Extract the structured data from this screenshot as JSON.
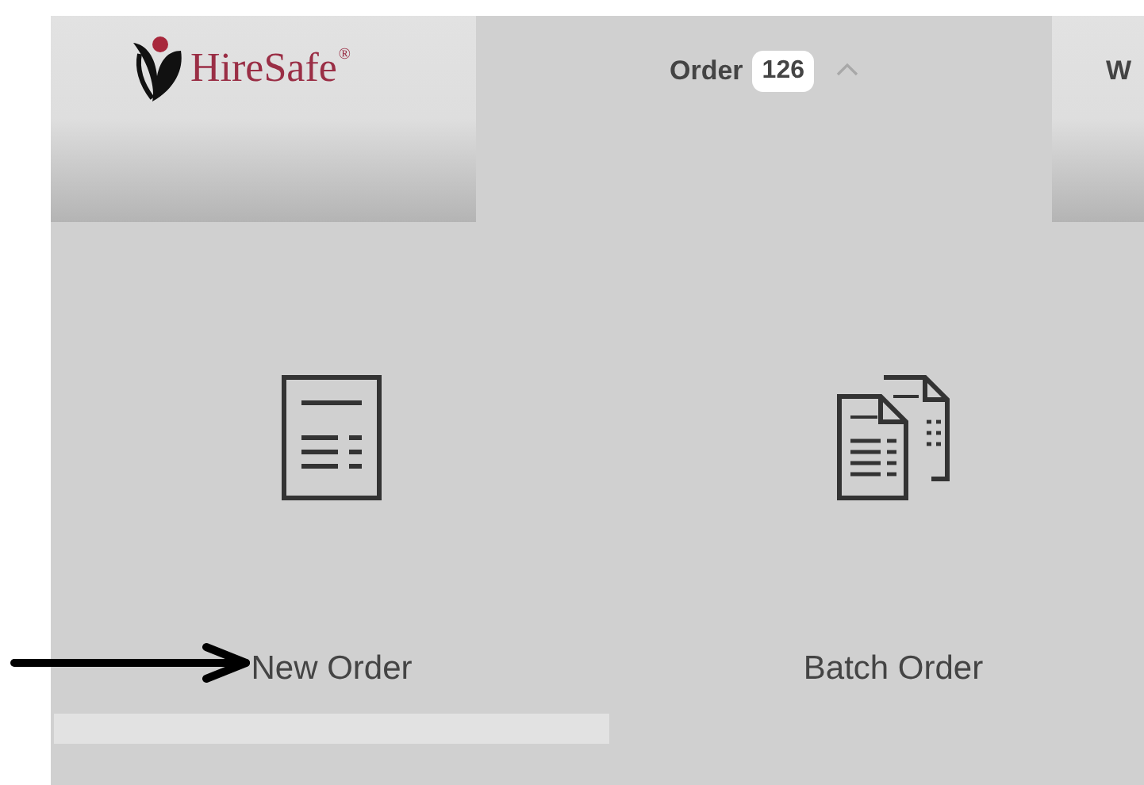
{
  "logo": {
    "text": "HireSafe",
    "mark": "®"
  },
  "tabs": [
    {
      "label": "Order",
      "badge": "126",
      "selected": true,
      "expanded": true
    },
    {
      "label": "W",
      "selected": false
    }
  ],
  "items": [
    {
      "kind": "single",
      "label": "New Order",
      "selected": true
    },
    {
      "kind": "batch",
      "label": "Batch Order",
      "selected": false
    }
  ]
}
